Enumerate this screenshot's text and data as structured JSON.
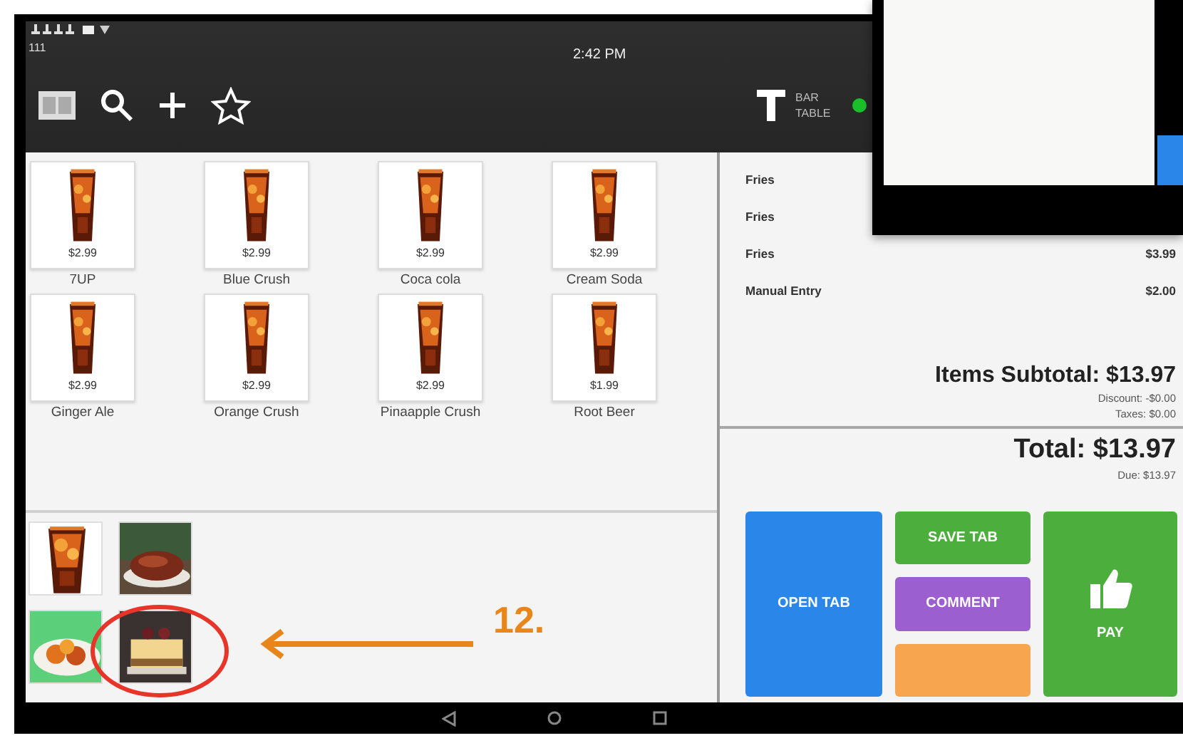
{
  "status_bar": {
    "signal_text": "111",
    "time": "2:42 PM"
  },
  "toolbar": {
    "table_label": "BAR TABLE"
  },
  "products": [
    {
      "name": "7UP",
      "price": "$2.99"
    },
    {
      "name": "Blue Crush",
      "price": "$2.99"
    },
    {
      "name": "Coca cola",
      "price": "$2.99"
    },
    {
      "name": "Cream Soda",
      "price": "$2.99"
    },
    {
      "name": "Ginger Ale",
      "price": "$2.99"
    },
    {
      "name": "Orange Crush",
      "price": "$2.99"
    },
    {
      "name": "Pinaapple Crush",
      "price": "$2.99"
    },
    {
      "name": "Root Beer",
      "price": "$1.99"
    }
  ],
  "categories": [
    {
      "kind": "drink"
    },
    {
      "kind": "meat"
    },
    {
      "kind": "appetizer"
    },
    {
      "kind": "dessert"
    }
  ],
  "order": {
    "items": [
      {
        "name": "Fries"
      },
      {
        "name": "Fries"
      },
      {
        "name": "Fries",
        "price": "$3.99"
      },
      {
        "name": "Manual Entry",
        "price": "$2.00"
      }
    ],
    "subtotal": "Items Subtotal: $13.97",
    "discount": "Discount: -$0.00",
    "taxes": "Taxes: $0.00",
    "total": "Total: $13.97",
    "due": "Due: $13.97"
  },
  "actions": [
    {
      "kind": "tall",
      "label": "OPEN TAB",
      "color": "#2a86e8"
    },
    {
      "kind": "small",
      "label": "SAVE TAB",
      "color": "#4cae3c"
    },
    {
      "kind": "small",
      "label": "COMMENT",
      "color": "#9b5fd0"
    },
    {
      "kind": "small",
      "color": "#f7a54e"
    },
    {
      "kind": "pay",
      "label": "PAY",
      "color": "#4cae3c"
    }
  ],
  "annotation": {
    "label": "12."
  }
}
